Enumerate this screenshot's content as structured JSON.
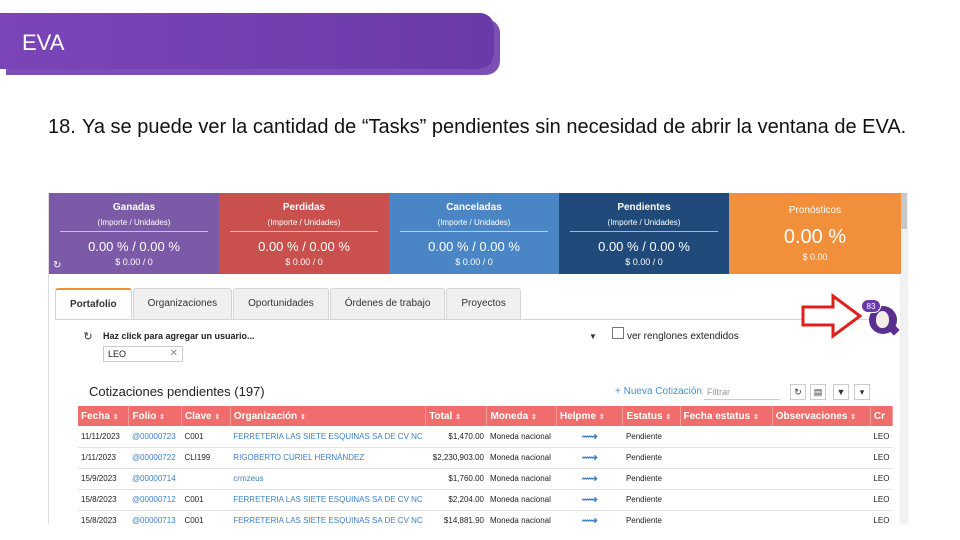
{
  "banner": {
    "title": "EVA"
  },
  "step": {
    "number": "18.",
    "text": "Ya se puede ver la cantidad de “Tasks” pendientes sin necesidad de abrir la ventana de EVA."
  },
  "cards": [
    {
      "title": "Ganadas",
      "sub": "(Importe / Unidades)",
      "value": "0.00 % / 0.00 %",
      "small": "$ 0.00 / 0",
      "color": "#7b5ba8"
    },
    {
      "title": "Perdidas",
      "sub": "(Importe / Unidades)",
      "value": "0.00 % / 0.00 %",
      "small": "$ 0.00 / 0",
      "color": "#c9504d"
    },
    {
      "title": "Canceladas",
      "sub": "(Importe / Unidades)",
      "value": "0.00 % / 0.00 %",
      "small": "$ 0.00 / 0",
      "color": "#4a86c5"
    },
    {
      "title": "Pendientes",
      "sub": "(Importe / Unidades)",
      "value": "0.00 % / 0.00 %",
      "small": "$ 0.00 / 0",
      "color": "#204a7a"
    },
    {
      "title": "Pronósticos",
      "value": "0.00 %",
      "small": "$ 0.00",
      "color": "#f28f3b"
    }
  ],
  "tabs": [
    "Portafolio",
    "Organizaciones",
    "Oportunidades",
    "Órdenes de trabajo",
    "Proyectos"
  ],
  "eva": {
    "badge": "83"
  },
  "filters": {
    "user_placeholder": "Haz click para agregar un usuario...",
    "chip": "LEO",
    "extended_rows": "ver renglones extendidos"
  },
  "section": {
    "title": "Cotizaciones pendientes (197)",
    "new_link": "+ Nueva Cotización",
    "filter_placeholder": "Filtrar"
  },
  "table": {
    "columns": [
      "Fecha",
      "Folio",
      "Clave",
      "Organización",
      "Total",
      "Moneda",
      "Helpme",
      "Estatus",
      "Fecha estatus",
      "Observaciones",
      "Cr"
    ],
    "rows": [
      [
        "11/11/2023",
        "@00000723",
        "C001",
        "FERRETERIA LAS SIETE ESQUINAS SA DE CV NC",
        "$1,470.00",
        "Moneda nacional",
        "Pendiente",
        "LEO"
      ],
      [
        "1/11/2023",
        "@00000722",
        "CLI199",
        "RIGOBERTO CURIEL HERNÁNDEZ",
        "$2,230,903.00",
        "Moneda nacional",
        "Pendiente",
        "LEO"
      ],
      [
        "15/9/2023",
        "@00000714",
        "",
        "crmzeus",
        "$1,760.00",
        "Moneda nacional",
        "Pendiente",
        "LEO"
      ],
      [
        "15/8/2023",
        "@00000712",
        "C001",
        "FERRETERIA LAS SIETE ESQUINAS SA DE CV NC",
        "$2,204.00",
        "Moneda nacional",
        "Pendiente",
        "LEO"
      ],
      [
        "15/8/2023",
        "@00000713",
        "C001",
        "FERRETERIA LAS SIETE ESQUINAS SA DE CV NC",
        "$14,881.90",
        "Moneda nacional",
        "Pendiente",
        "LEO"
      ]
    ]
  },
  "colors": {
    "banner": "#6f3fae",
    "header_row": "#f16d6d",
    "tab_accent": "#f0912e",
    "link": "#3d7fc8"
  }
}
